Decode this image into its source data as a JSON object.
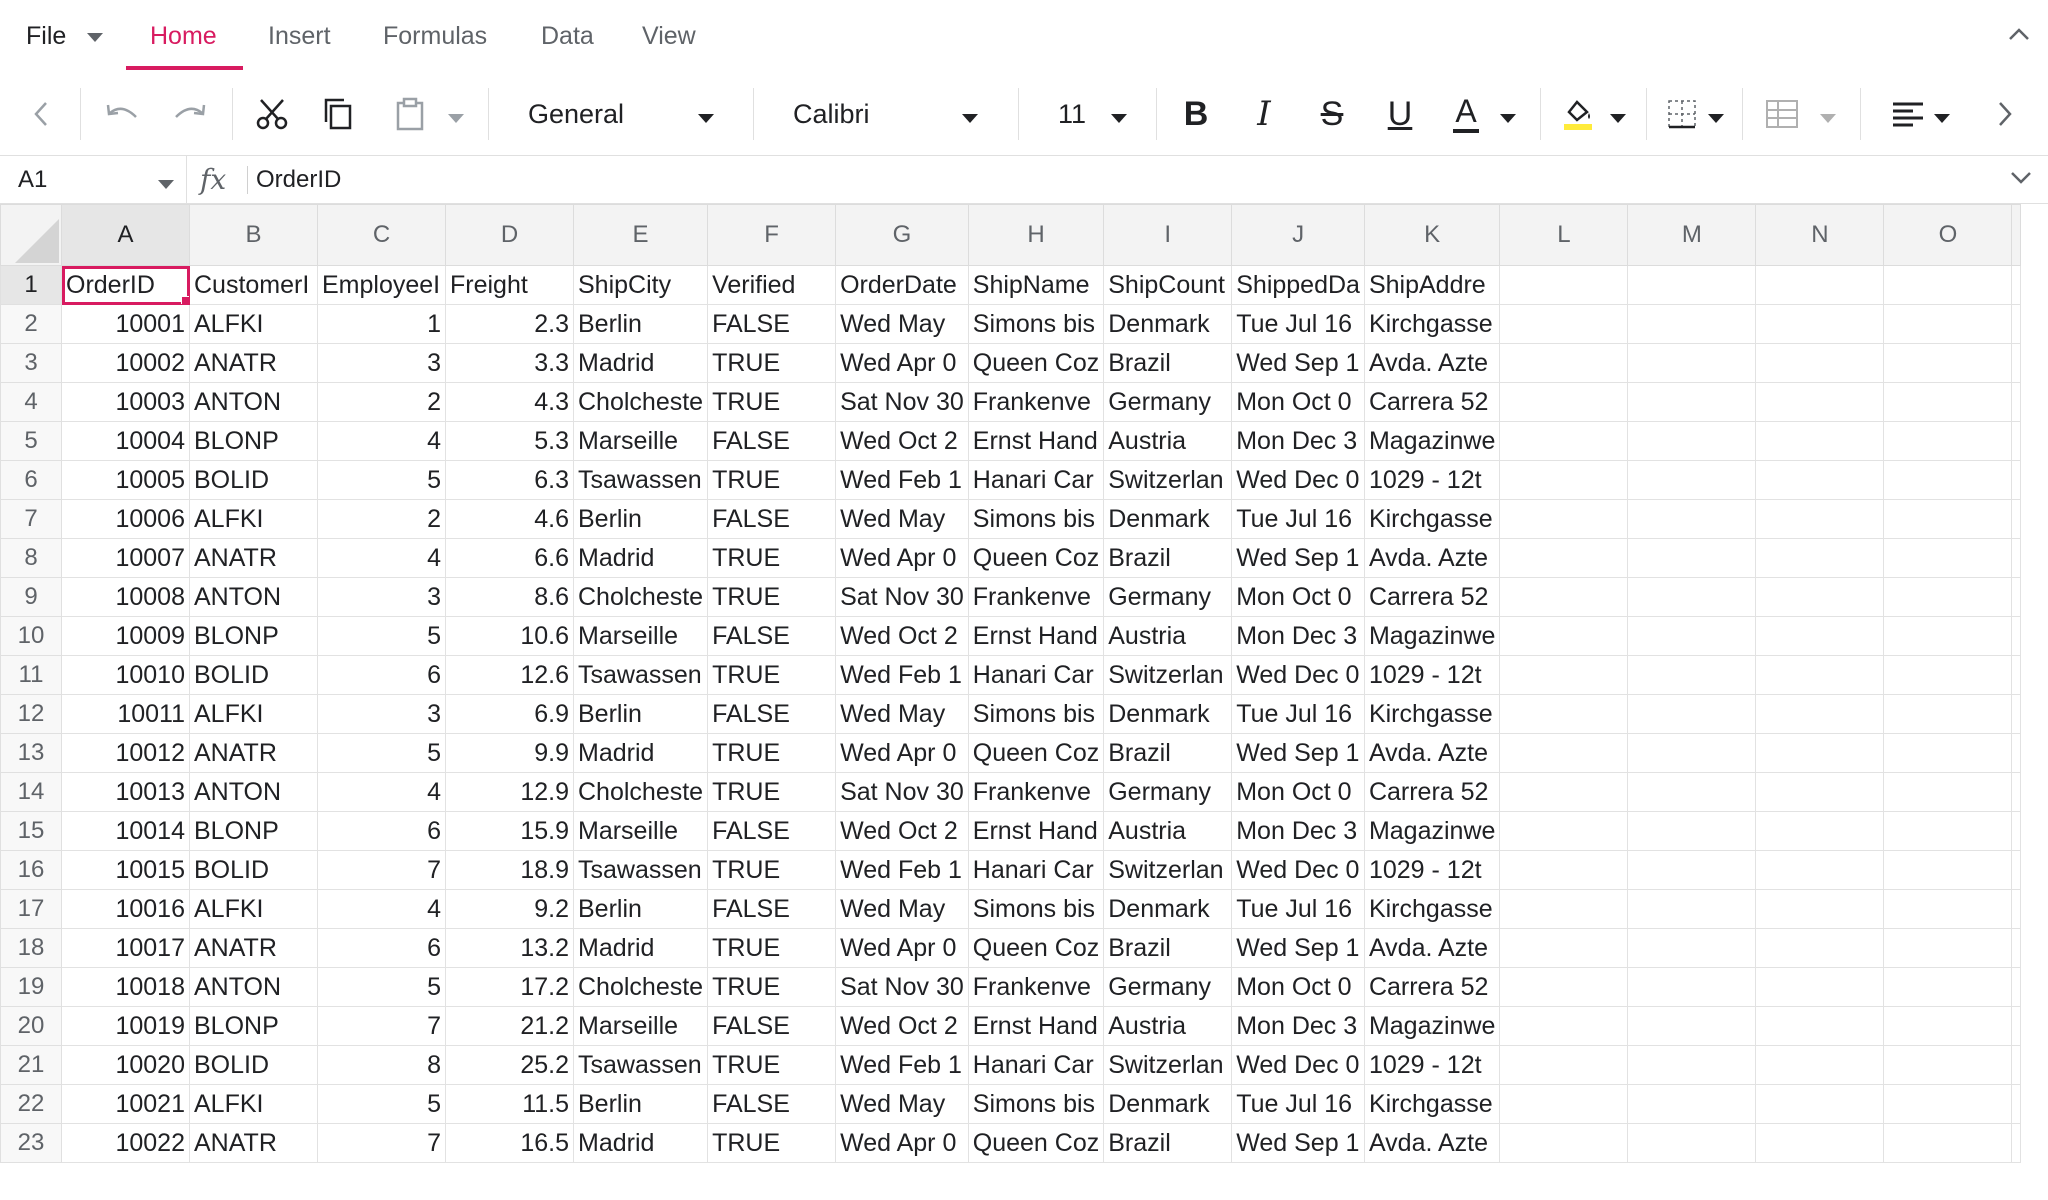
{
  "menu": {
    "file_label": "File",
    "tabs": [
      "Home",
      "Insert",
      "Formulas",
      "Data",
      "View"
    ],
    "active_tab": "Home"
  },
  "ribbon": {
    "number_format": "General",
    "font_family": "Calibri",
    "font_size": "11",
    "bold_label": "B",
    "italic_label": "I",
    "strike_label": "S",
    "underline_label": "U",
    "font_color_label": "A",
    "accent_color": "#d81b60",
    "fill_color": "#ffeb3b",
    "font_color": "#d81b60"
  },
  "formula_bar": {
    "name_box": "A1",
    "fx_label": "fx",
    "value": "OrderID"
  },
  "sheet": {
    "columns": [
      "A",
      "B",
      "C",
      "D",
      "E",
      "F",
      "G",
      "H",
      "I",
      "J",
      "K",
      "L",
      "M",
      "N",
      "O"
    ],
    "active_cell": "A1",
    "rows": [
      [
        "1",
        "OrderID",
        "CustomerI",
        "EmployeeI",
        "Freight",
        "ShipCity",
        "Verified",
        "OrderDate",
        "ShipName",
        "ShipCount",
        "ShippedDa",
        "ShipAddre"
      ],
      [
        "2",
        "10001",
        "ALFKI",
        "1",
        "2.3",
        "Berlin",
        "FALSE",
        "Wed May",
        "Simons bis",
        "Denmark",
        "Tue Jul 16",
        "Kirchgasse"
      ],
      [
        "3",
        "10002",
        "ANATR",
        "3",
        "3.3",
        "Madrid",
        "TRUE",
        "Wed Apr 0",
        "Queen Coz",
        "Brazil",
        "Wed Sep 1",
        "Avda. Azte"
      ],
      [
        "4",
        "10003",
        "ANTON",
        "2",
        "4.3",
        "Cholcheste",
        "TRUE",
        "Sat Nov 30",
        "Frankenve",
        "Germany",
        "Mon Oct 0",
        "Carrera 52"
      ],
      [
        "5",
        "10004",
        "BLONP",
        "4",
        "5.3",
        "Marseille",
        "FALSE",
        "Wed Oct 2",
        "Ernst Hand",
        "Austria",
        "Mon Dec 3",
        "Magazinwe"
      ],
      [
        "6",
        "10005",
        "BOLID",
        "5",
        "6.3",
        "Tsawassen",
        "TRUE",
        "Wed Feb 1",
        "Hanari Car",
        "Switzerlan",
        "Wed Dec 0",
        "1029 - 12t"
      ],
      [
        "7",
        "10006",
        "ALFKI",
        "2",
        "4.6",
        "Berlin",
        "FALSE",
        "Wed May",
        "Simons bis",
        "Denmark",
        "Tue Jul 16",
        "Kirchgasse"
      ],
      [
        "8",
        "10007",
        "ANATR",
        "4",
        "6.6",
        "Madrid",
        "TRUE",
        "Wed Apr 0",
        "Queen Coz",
        "Brazil",
        "Wed Sep 1",
        "Avda. Azte"
      ],
      [
        "9",
        "10008",
        "ANTON",
        "3",
        "8.6",
        "Cholcheste",
        "TRUE",
        "Sat Nov 30",
        "Frankenve",
        "Germany",
        "Mon Oct 0",
        "Carrera 52"
      ],
      [
        "10",
        "10009",
        "BLONP",
        "5",
        "10.6",
        "Marseille",
        "FALSE",
        "Wed Oct 2",
        "Ernst Hand",
        "Austria",
        "Mon Dec 3",
        "Magazinwe"
      ],
      [
        "11",
        "10010",
        "BOLID",
        "6",
        "12.6",
        "Tsawassen",
        "TRUE",
        "Wed Feb 1",
        "Hanari Car",
        "Switzerlan",
        "Wed Dec 0",
        "1029 - 12t"
      ],
      [
        "12",
        "10011",
        "ALFKI",
        "3",
        "6.9",
        "Berlin",
        "FALSE",
        "Wed May",
        "Simons bis",
        "Denmark",
        "Tue Jul 16",
        "Kirchgasse"
      ],
      [
        "13",
        "10012",
        "ANATR",
        "5",
        "9.9",
        "Madrid",
        "TRUE",
        "Wed Apr 0",
        "Queen Coz",
        "Brazil",
        "Wed Sep 1",
        "Avda. Azte"
      ],
      [
        "14",
        "10013",
        "ANTON",
        "4",
        "12.9",
        "Cholcheste",
        "TRUE",
        "Sat Nov 30",
        "Frankenve",
        "Germany",
        "Mon Oct 0",
        "Carrera 52"
      ],
      [
        "15",
        "10014",
        "BLONP",
        "6",
        "15.9",
        "Marseille",
        "FALSE",
        "Wed Oct 2",
        "Ernst Hand",
        "Austria",
        "Mon Dec 3",
        "Magazinwe"
      ],
      [
        "16",
        "10015",
        "BOLID",
        "7",
        "18.9",
        "Tsawassen",
        "TRUE",
        "Wed Feb 1",
        "Hanari Car",
        "Switzerlan",
        "Wed Dec 0",
        "1029 - 12t"
      ],
      [
        "17",
        "10016",
        "ALFKI",
        "4",
        "9.2",
        "Berlin",
        "FALSE",
        "Wed May",
        "Simons bis",
        "Denmark",
        "Tue Jul 16",
        "Kirchgasse"
      ],
      [
        "18",
        "10017",
        "ANATR",
        "6",
        "13.2",
        "Madrid",
        "TRUE",
        "Wed Apr 0",
        "Queen Coz",
        "Brazil",
        "Wed Sep 1",
        "Avda. Azte"
      ],
      [
        "19",
        "10018",
        "ANTON",
        "5",
        "17.2",
        "Cholcheste",
        "TRUE",
        "Sat Nov 30",
        "Frankenve",
        "Germany",
        "Mon Oct 0",
        "Carrera 52"
      ],
      [
        "20",
        "10019",
        "BLONP",
        "7",
        "21.2",
        "Marseille",
        "FALSE",
        "Wed Oct 2",
        "Ernst Hand",
        "Austria",
        "Mon Dec 3",
        "Magazinwe"
      ],
      [
        "21",
        "10020",
        "BOLID",
        "8",
        "25.2",
        "Tsawassen",
        "TRUE",
        "Wed Feb 1",
        "Hanari Car",
        "Switzerlan",
        "Wed Dec 0",
        "1029 - 12t"
      ],
      [
        "22",
        "10021",
        "ALFKI",
        "5",
        "11.5",
        "Berlin",
        "FALSE",
        "Wed May",
        "Simons bis",
        "Denmark",
        "Tue Jul 16",
        "Kirchgasse"
      ],
      [
        "23",
        "10022",
        "ANATR",
        "7",
        "16.5",
        "Madrid",
        "TRUE",
        "Wed Apr 0",
        "Queen Coz",
        "Brazil",
        "Wed Sep 1",
        "Avda. Azte"
      ]
    ]
  }
}
